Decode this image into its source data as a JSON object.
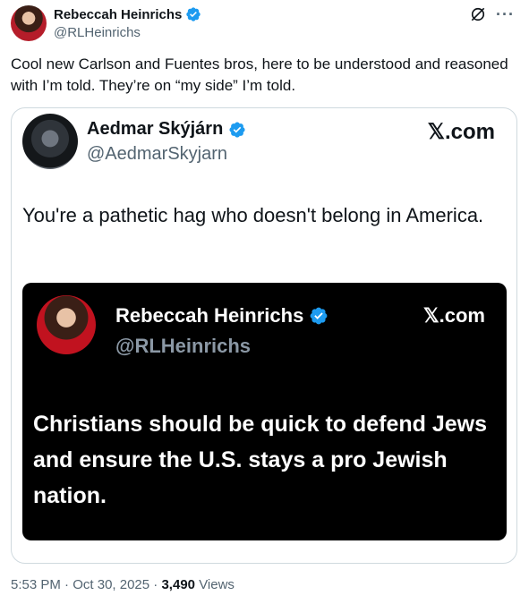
{
  "post": {
    "author_name": "Rebeccah Heinrichs",
    "author_handle": "@RLHeinrichs",
    "text": "Cool new Carlson and Fuentes bros, here to be understood and reasoned with I’m told. They’re on “my side” I’m told.",
    "time": "5:53 PM",
    "separator": "·",
    "date": "Oct 30, 2025",
    "views_count": "3,490",
    "views_label": "Views",
    "more_icon": "more-icon",
    "grok_icon": "grok-icon"
  },
  "quoted": {
    "author_name": "Aedmar Skýjárn",
    "author_handle": "@AedmarSkyjarn",
    "source": "𝕏.com",
    "text": "You're a pathetic hag who doesn't belong in America."
  },
  "inner": {
    "author_name": "Rebeccah Heinrichs",
    "author_handle": "@RLHeinrichs",
    "source": "𝕏.com",
    "text": "Christians should be quick to defend Jews and ensure the U.S. stays a pro Jewish nation."
  },
  "colors": {
    "verified": "#1d9bf0",
    "text": "#0f1419",
    "muted": "#536471",
    "border": "#cfd9de"
  }
}
